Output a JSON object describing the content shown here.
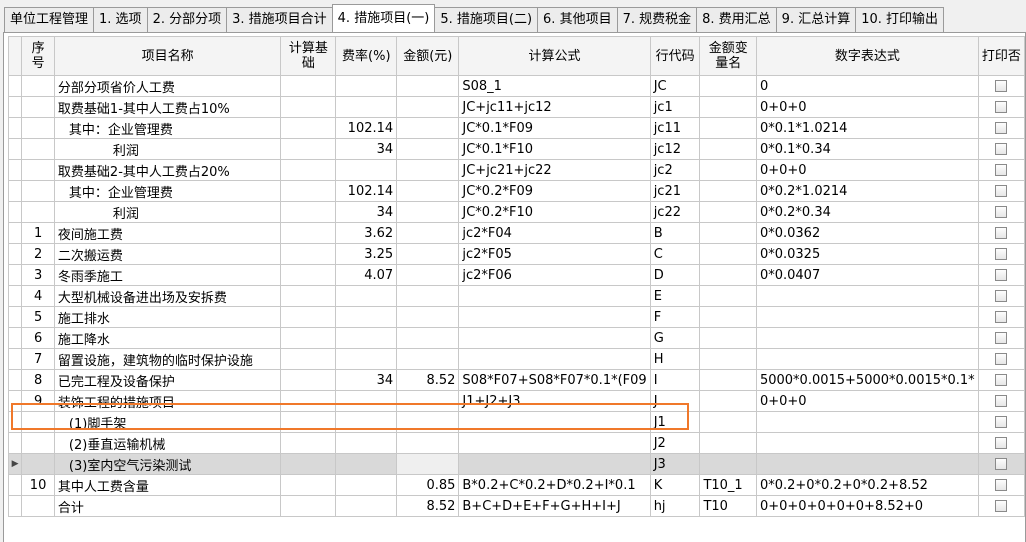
{
  "tabs": [
    "单位工程管理",
    "1. 选项",
    "2. 分部分项",
    "3. 措施项目合计",
    "4. 措施项目(一)",
    "5. 措施项目(二)",
    "6. 其他项目",
    "7. 规费税金",
    "8. 费用汇总",
    "9. 汇总计算",
    "10. 打印输出"
  ],
  "active_tab": 4,
  "columns": [
    "序号",
    "项目名称",
    "计算基础",
    "费率(%)",
    "金额(元)",
    "计算公式",
    "行代码",
    "金额变量名",
    "数字表达式",
    "打印否"
  ],
  "rows": [
    {
      "seq": "",
      "name": "分部分项省价人工费",
      "base": "",
      "rate": "",
      "amount": "",
      "formula": "S08_1",
      "code": "JC",
      "var": "",
      "expr": "0",
      "indent": 0
    },
    {
      "seq": "",
      "name": "取费基础1-其中人工费占10%",
      "base": "",
      "rate": "",
      "amount": "",
      "formula": "JC+jc11+jc12",
      "code": "jc1",
      "var": "",
      "expr": "0+0+0",
      "indent": 0
    },
    {
      "seq": "",
      "name": "其中：企业管理费",
      "base": "",
      "rate": "102.14",
      "amount": "",
      "formula": "JC*0.1*F09",
      "code": "jc11",
      "var": "",
      "expr": "0*0.1*1.0214",
      "indent": 1
    },
    {
      "seq": "",
      "name": "利润",
      "base": "",
      "rate": "34",
      "amount": "",
      "formula": "JC*0.1*F10",
      "code": "jc12",
      "var": "",
      "expr": "0*0.1*0.34",
      "indent": 2
    },
    {
      "seq": "",
      "name": "取费基础2-其中人工费占20%",
      "base": "",
      "rate": "",
      "amount": "",
      "formula": "JC+jc21+jc22",
      "code": "jc2",
      "var": "",
      "expr": "0+0+0",
      "indent": 0
    },
    {
      "seq": "",
      "name": "其中：企业管理费",
      "base": "",
      "rate": "102.14",
      "amount": "",
      "formula": "JC*0.2*F09",
      "code": "jc21",
      "var": "",
      "expr": "0*0.2*1.0214",
      "indent": 1
    },
    {
      "seq": "",
      "name": "利润",
      "base": "",
      "rate": "34",
      "amount": "",
      "formula": "JC*0.2*F10",
      "code": "jc22",
      "var": "",
      "expr": "0*0.2*0.34",
      "indent": 2
    },
    {
      "seq": "1",
      "name": "夜间施工费",
      "base": "",
      "rate": "3.62",
      "amount": "",
      "formula": "jc2*F04",
      "code": "B",
      "var": "",
      "expr": "0*0.0362",
      "indent": 0
    },
    {
      "seq": "2",
      "name": "二次搬运费",
      "base": "",
      "rate": "3.25",
      "amount": "",
      "formula": "jc2*F05",
      "code": "C",
      "var": "",
      "expr": "0*0.0325",
      "indent": 0
    },
    {
      "seq": "3",
      "name": "冬雨季施工",
      "base": "",
      "rate": "4.07",
      "amount": "",
      "formula": "jc2*F06",
      "code": "D",
      "var": "",
      "expr": "0*0.0407",
      "indent": 0
    },
    {
      "seq": "4",
      "name": "大型机械设备进出场及安拆费",
      "base": "",
      "rate": "",
      "amount": "",
      "formula": "",
      "code": "E",
      "var": "",
      "expr": "",
      "indent": 0
    },
    {
      "seq": "5",
      "name": "施工排水",
      "base": "",
      "rate": "",
      "amount": "",
      "formula": "",
      "code": "F",
      "var": "",
      "expr": "",
      "indent": 0
    },
    {
      "seq": "6",
      "name": "施工降水",
      "base": "",
      "rate": "",
      "amount": "",
      "formula": "",
      "code": "G",
      "var": "",
      "expr": "",
      "indent": 0
    },
    {
      "seq": "7",
      "name": "留置设施，建筑物的临时保护设施",
      "base": "",
      "rate": "",
      "amount": "",
      "formula": "",
      "code": "H",
      "var": "",
      "expr": "",
      "indent": 0
    },
    {
      "seq": "8",
      "name": "已完工程及设备保护",
      "base": "",
      "rate": "34",
      "amount": "8.52",
      "formula": "S08*F07+S08*F07*0.1*(F09",
      "code": "I",
      "var": "",
      "expr": "5000*0.0015+5000*0.0015*0.1*",
      "indent": 0
    },
    {
      "seq": "9",
      "name": "装饰工程的措施项目",
      "base": "",
      "rate": "",
      "amount": "",
      "formula": "J1+J2+J3",
      "code": "J",
      "var": "",
      "expr": "0+0+0",
      "indent": 0
    },
    {
      "seq": "",
      "name": "(1)脚手架",
      "base": "",
      "rate": "",
      "amount": "",
      "formula": "",
      "code": "J1",
      "var": "",
      "expr": "",
      "indent": 1
    },
    {
      "seq": "",
      "name": "(2)垂直运输机械",
      "base": "",
      "rate": "",
      "amount": "",
      "formula": "",
      "code": "J2",
      "var": "",
      "expr": "",
      "indent": 1
    },
    {
      "seq": "",
      "name": "(3)室内空气污染测试",
      "base": "",
      "rate": "",
      "amount": "",
      "formula": "",
      "code": "J3",
      "var": "",
      "expr": "",
      "indent": 1,
      "selected": true
    },
    {
      "seq": "10",
      "name": "其中人工费含量",
      "base": "",
      "rate": "",
      "amount": "0.85",
      "formula": "B*0.2+C*0.2+D*0.2+I*0.1",
      "code": "K",
      "var": "T10_1",
      "expr": "0*0.2+0*0.2+0*0.2+8.52",
      "indent": 0
    },
    {
      "seq": "",
      "name": "合计",
      "base": "",
      "rate": "",
      "amount": "8.52",
      "formula": "B+C+D+E+F+G+H+I+J",
      "code": "hj",
      "var": "T10",
      "expr": "0+0+0+0+0+0+8.52+0",
      "indent": 0
    }
  ],
  "selected_row_marker": "▶",
  "highlight_color": "#f0782a"
}
